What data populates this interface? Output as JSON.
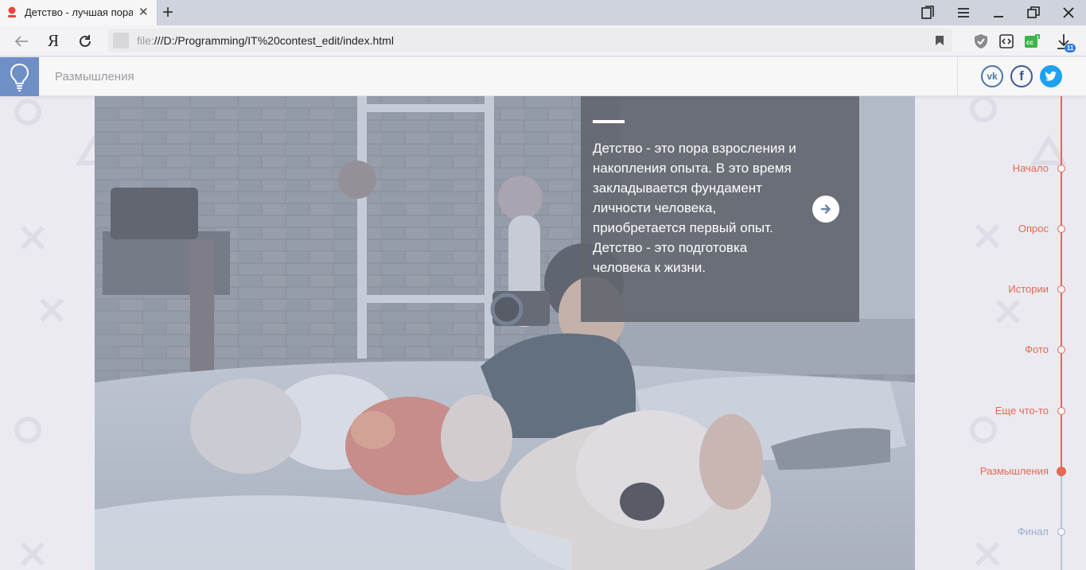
{
  "browser": {
    "tab_title": "Детство - лучшая пора",
    "address_scheme": "file:",
    "address_rest": "///D:/Programming/IT%20contest_edit/index.html",
    "downloads_badge": "11",
    "browser_logo": "Я"
  },
  "site": {
    "section_title": "Размышления",
    "social": [
      "vk",
      "facebook",
      "twitter"
    ],
    "social_labels": {
      "vk": "vk",
      "facebook": "f"
    }
  },
  "quote": {
    "text": "Детство - это пора взросления и накопления опыта. В это время закладывается фундамент личности человека, приобретается первый опыт. Детство - это подготовка человека к жизни."
  },
  "timeline": {
    "items": [
      {
        "label": "Начало",
        "state": "done"
      },
      {
        "label": "Опрос",
        "state": "done"
      },
      {
        "label": "Истории",
        "state": "done"
      },
      {
        "label": "Фото",
        "state": "done"
      },
      {
        "label": "Еще что-то",
        "state": "done"
      },
      {
        "label": "Размышления",
        "state": "active"
      },
      {
        "label": "Финал",
        "state": "future"
      }
    ]
  },
  "colors": {
    "accent": "#e06a52",
    "future": "#9bb0cc",
    "logo_bg": "#6f8fc7",
    "vk": "#4a76a8",
    "facebook": "#3b5998",
    "twitter": "#1da1f2"
  }
}
